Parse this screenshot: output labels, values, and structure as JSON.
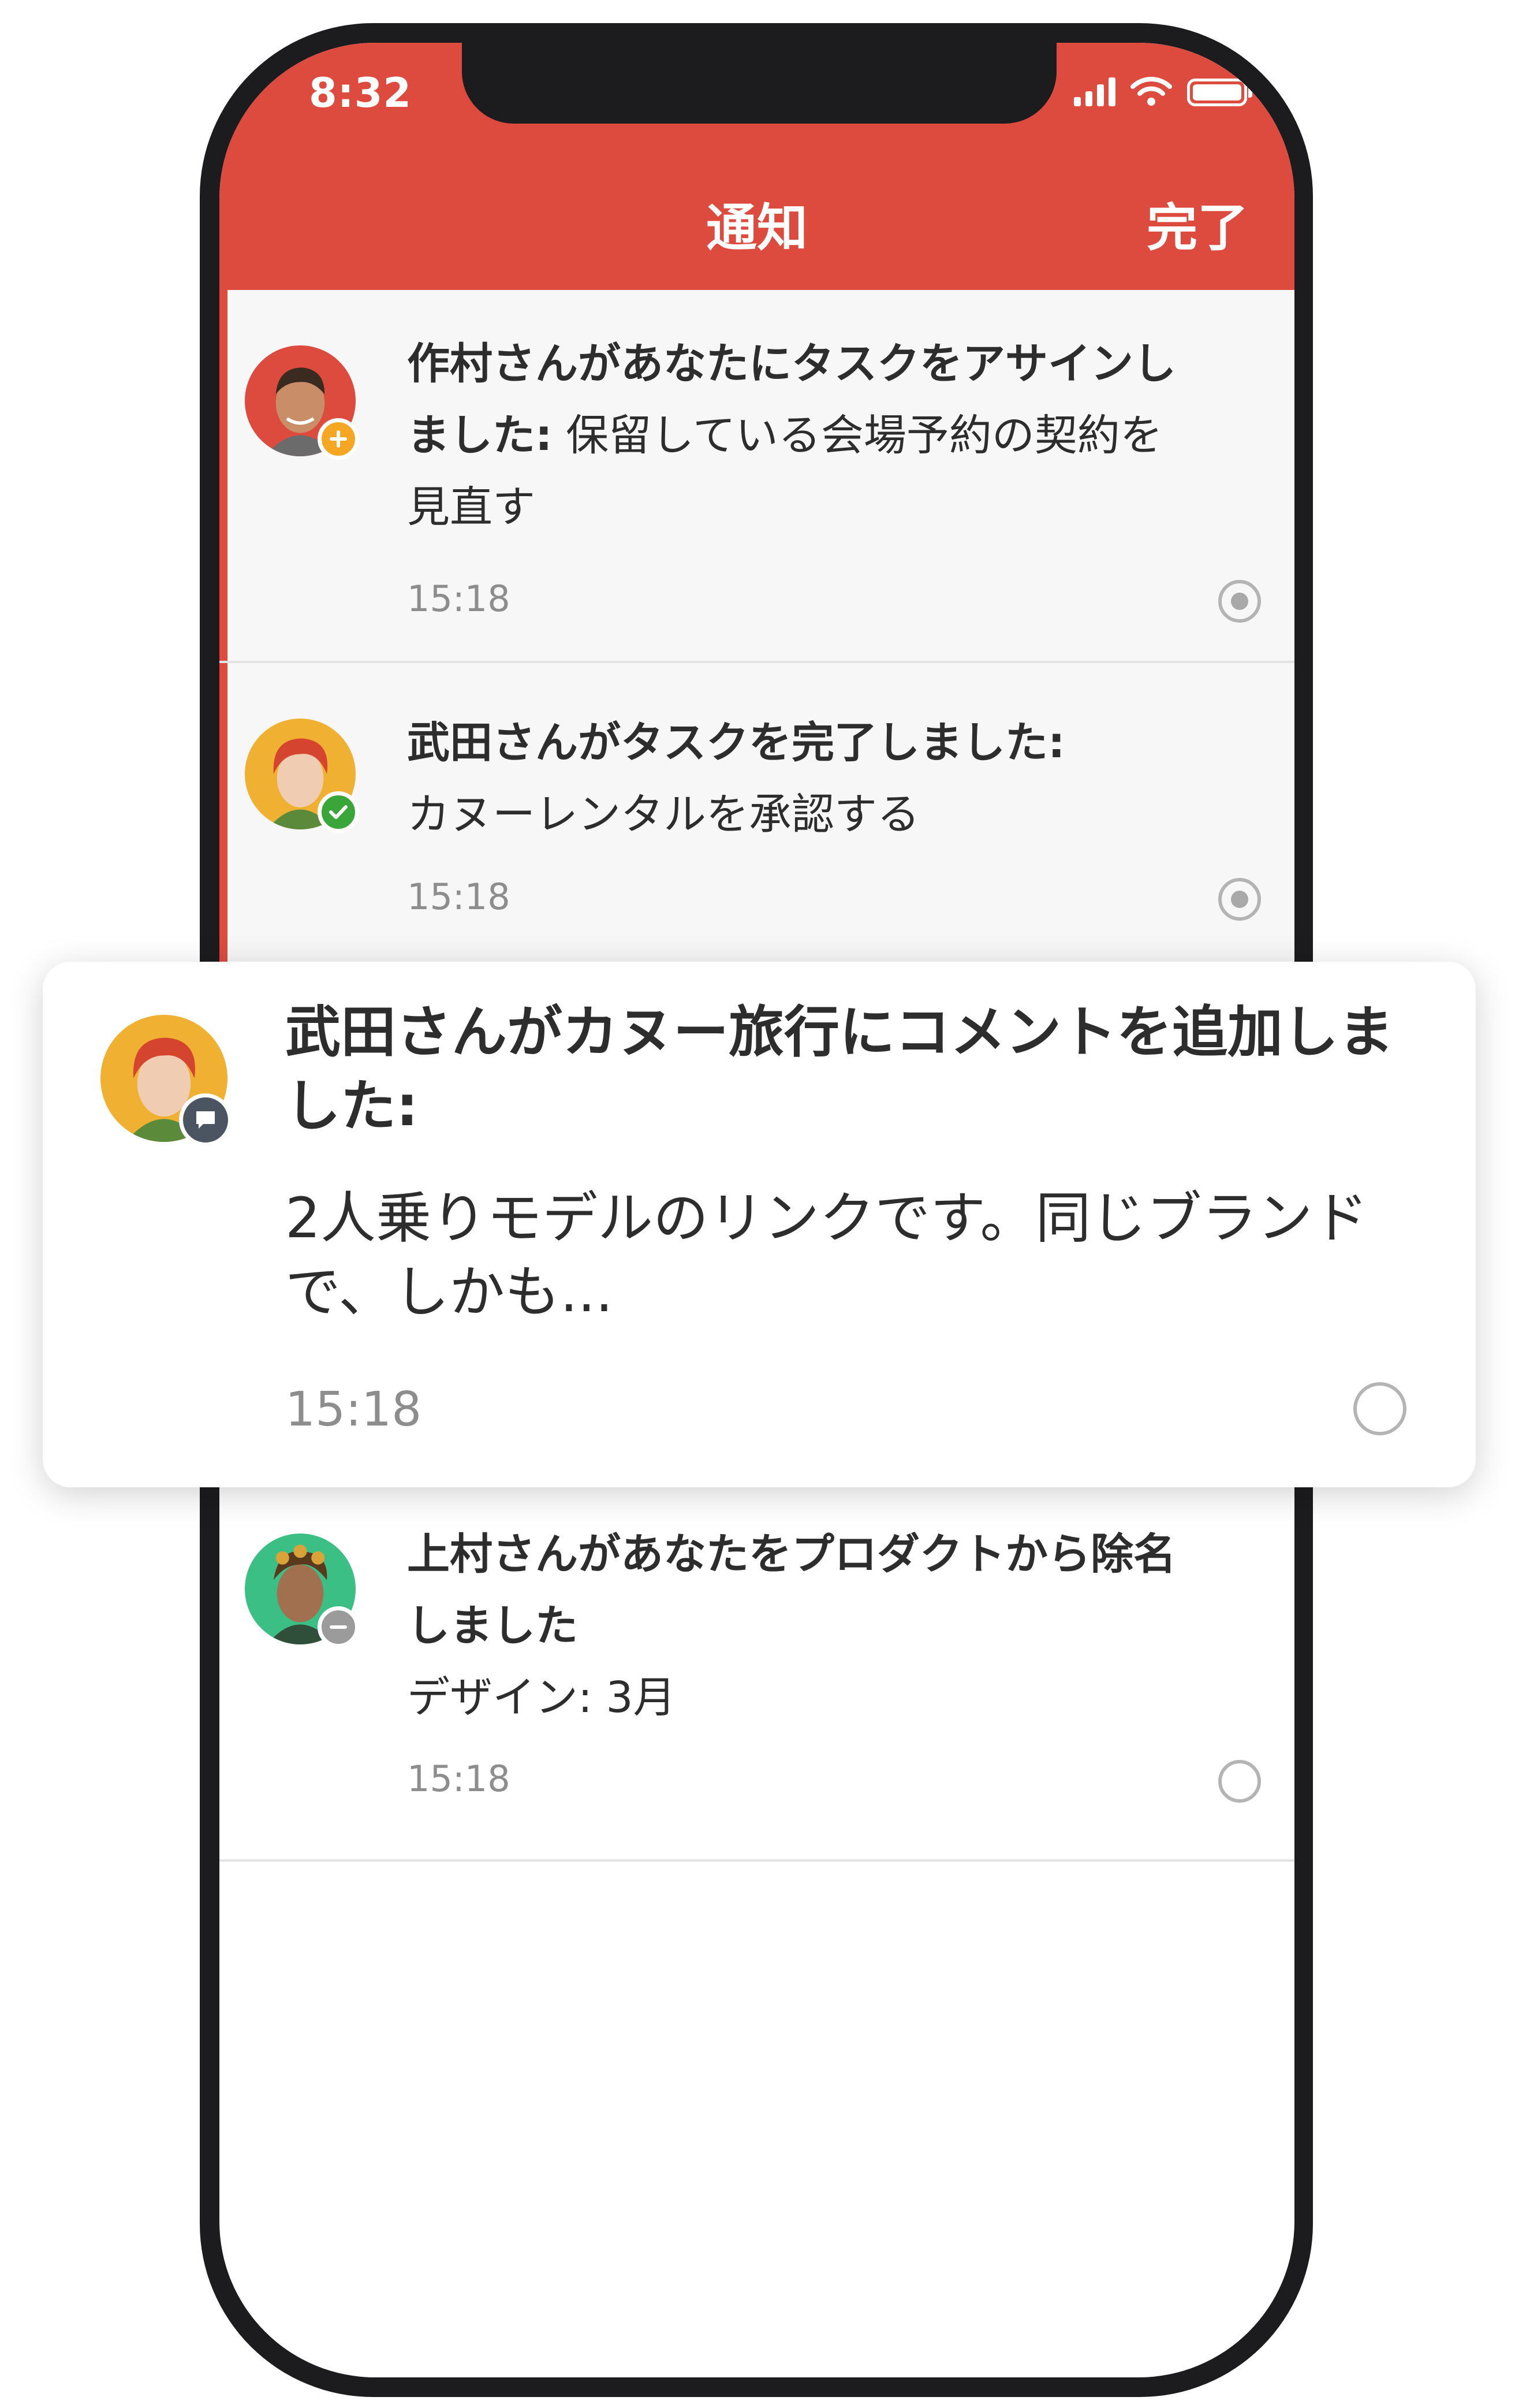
{
  "status_bar": {
    "time": "8:32"
  },
  "header": {
    "title": "通知",
    "done_label": "完了"
  },
  "notifications": [
    {
      "bold": "作村さんがあなたにタスクをアサインしました:",
      "body": " 保留している会場予約の契約を見直す",
      "time": "15:18",
      "badge": "plus-icon",
      "badge_color": "#f5a623",
      "state": "unread"
    },
    {
      "bold": "武田さんがタスクを完了しました:",
      "body": "カヌーレンタルを承認する",
      "time": "15:18",
      "badge": "check-icon",
      "badge_color": "#3aa63a",
      "state": "unread"
    },
    {
      "bold": "上村さんがあなたをプロダクトから除名しました",
      "body": "デザイン: 3月",
      "time": "15:18",
      "badge": "minus-icon",
      "badge_color": "#9b9b9b",
      "state": "read"
    }
  ],
  "popup": {
    "bold": "武田さんがカヌー旅行にコメントを追加しました:",
    "body": "2人乗りモデルのリンクです。同じブランドで、しかも...",
    "time": "15:18",
    "badge": "comment-icon",
    "badge_color": "#4a5561"
  },
  "colors": {
    "accent": "#dc4b3e",
    "frame": "#1c1c1e"
  }
}
